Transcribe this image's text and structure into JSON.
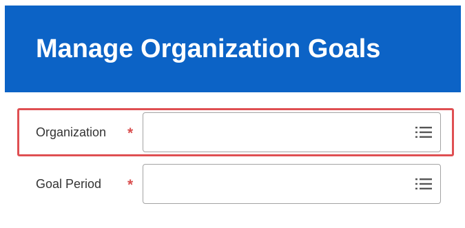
{
  "header": {
    "title": "Manage Organization Goals"
  },
  "form": {
    "fields": [
      {
        "label": "Organization",
        "required_marker": "*",
        "value": "",
        "placeholder": "",
        "icon": "list-prompt-icon"
      },
      {
        "label": "Goal Period",
        "required_marker": "*",
        "value": "",
        "placeholder": "",
        "icon": "list-prompt-icon"
      }
    ]
  },
  "colors": {
    "header_bg": "#0c63c6",
    "header_text": "#ffffff",
    "highlight_border": "#df4f52",
    "required_marker": "#d94f4f"
  }
}
